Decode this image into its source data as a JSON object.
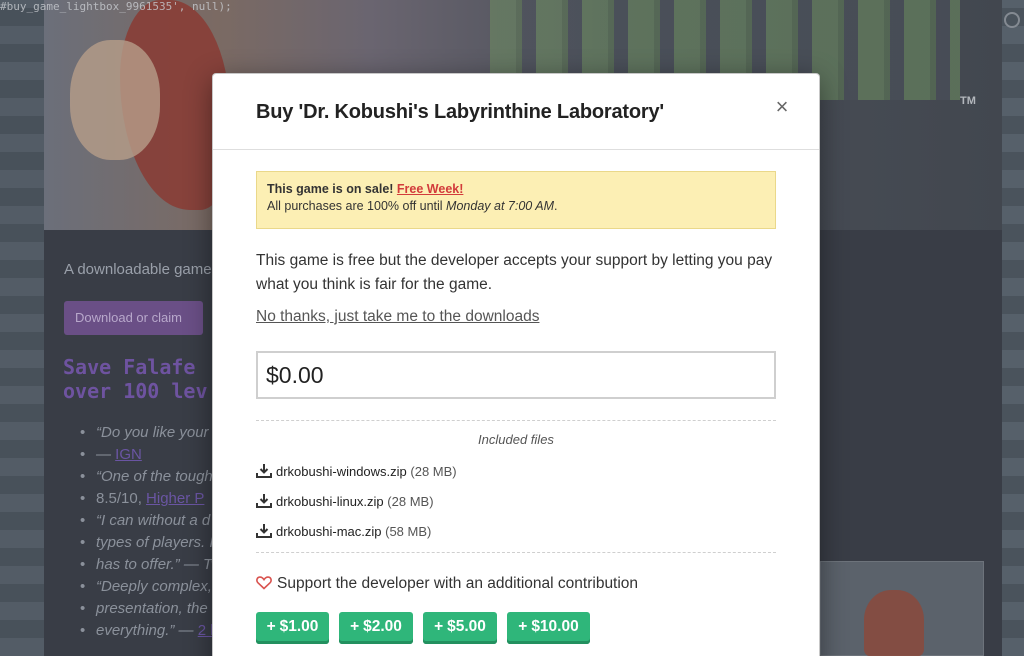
{
  "background": {
    "url_hint": "#buy_game_lightbox_9961535', null);",
    "tagline": "A downloadable game",
    "download_button": "Download or claim",
    "pixel_title_line1": "Save Falafe",
    "pixel_title_line2": "over 100 lev",
    "tm": "TM",
    "quotes": [
      {
        "text": "“Do you like your",
        "link": ""
      },
      {
        "text": "— ",
        "link": "IGN"
      },
      {
        "text": "“One of the tough",
        "link": ""
      },
      {
        "text": "8.5/10, ",
        "link": "Higher P"
      },
      {
        "text": "“I can without a d",
        "link": ""
      },
      {
        "text": "types of players. I",
        "link": ""
      },
      {
        "text": "has to offer.” — Tw",
        "link": ""
      },
      {
        "text": "“Deeply complex,",
        "link": ""
      },
      {
        "text": "presentation, the",
        "link": ""
      },
      {
        "text": "everything.” — ",
        "link": "2 l"
      }
    ]
  },
  "modal": {
    "title": "Buy 'Dr. Kobushi's Labyrinthine Laboratory'",
    "close_glyph": "×",
    "sale": {
      "prefix": "This game is on sale!",
      "link": "Free Week!",
      "line2_prefix": "All purchases are 100% off until ",
      "line2_time": "Monday at 7:00 AM",
      "line2_suffix": "."
    },
    "free_text": "This game is free but the developer accepts your support by letting you pay what you think is fair for the game.",
    "no_thanks": "No thanks, just take me to the downloads",
    "price_value": "$0.00",
    "files_heading": "Included files",
    "files": [
      {
        "name": "drkobushi-windows.zip",
        "size": "(28 MB)"
      },
      {
        "name": "drkobushi-linux.zip",
        "size": "(28 MB)"
      },
      {
        "name": "drkobushi-mac.zip",
        "size": "(58 MB)"
      }
    ],
    "support_text": "Support the developer with an additional contribution",
    "tips": [
      "$1.00",
      "$2.00",
      "$5.00",
      "$10.00"
    ]
  },
  "colors": {
    "accent_green": "#2fb67a",
    "sale_bg": "#fcefb4",
    "sale_link": "#d23b3b"
  }
}
